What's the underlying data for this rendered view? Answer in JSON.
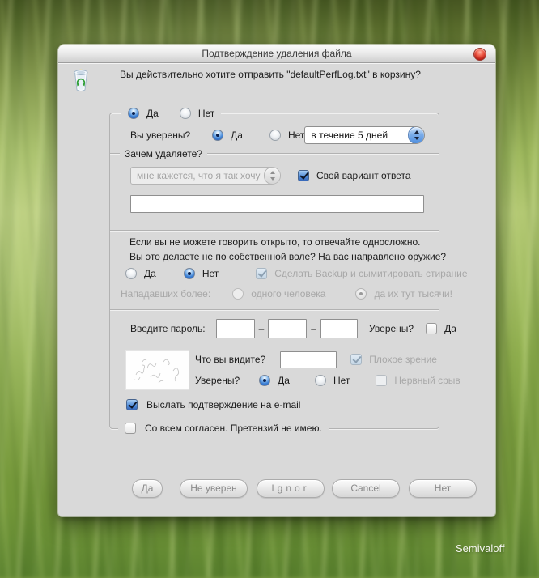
{
  "window": {
    "title": "Подтверждение удаления файла"
  },
  "message": "Вы действительно хотите отправить \"defaultPerfLog.txt\" в корзину?",
  "colors": {
    "accent_blue": "#3f83d6",
    "close_red": "#b51a12",
    "dialog_bg": "#d9d9d9"
  },
  "icons": {
    "close": "close-icon",
    "recycle_bin": "recycle-bin-icon",
    "dropdown_stepper": "updown-stepper-icon"
  },
  "main_choice": {
    "yes": "Да",
    "no": "Нет",
    "selected": "Да"
  },
  "sure_row": {
    "label": "Вы уверены?",
    "yes": "Да",
    "no": "Нет",
    "selected": "Да",
    "duration_dropdown": "в течение 5 дней"
  },
  "reason_group": {
    "legend": "Зачем удаляете?",
    "dropdown_value": "мне кажется, что я так хочу",
    "dropdown_disabled": true,
    "own_answer_checkbox": {
      "label": "Свой вариант ответа",
      "checked": true
    },
    "custom_answer_value": ""
  },
  "coercion_section": {
    "line1": "Если вы не можете говорить открыто, то отвечайте односложно.",
    "line2": "Вы это делаете не по собственной воле? На вас направлено оружие?",
    "yes": "Да",
    "no": "Нет",
    "selected": "Нет",
    "backup_checkbox": {
      "label": "Сделать Backup и сымитировать стирание",
      "checked": true,
      "disabled": true
    },
    "attackers": {
      "label": "Нападавших более:",
      "option1": "одного человека",
      "option2": "да их тут тысячи!",
      "selected": "да их тут тысячи!",
      "disabled": true
    }
  },
  "password_section": {
    "label": "Введите пароль:",
    "separator": "–",
    "values": [
      "",
      "",
      ""
    ],
    "sure_label": "Уверены?",
    "yes_label": "Да",
    "checked": false
  },
  "captcha_section": {
    "question": "Что вы видите?",
    "answer_value": "",
    "bad_vision_checkbox": {
      "label": "Плохое зрение",
      "checked": true,
      "disabled": true
    },
    "sure_label": "Уверены?",
    "yes": "Да",
    "no": "Нет",
    "selected": "Да",
    "breakdown_checkbox": {
      "label": "Нервный срыв",
      "checked": false,
      "disabled": true
    }
  },
  "email_checkbox": {
    "label": "Выслать подтверждение на e-mail",
    "checked": true
  },
  "agree_checkbox": {
    "label": "Со всем согласен. Претензий не имею.",
    "checked": false
  },
  "buttons": [
    "Да",
    "Не уверен",
    "Ignor",
    "Cancel",
    "Нет"
  ],
  "watermark": "Semivaloff"
}
